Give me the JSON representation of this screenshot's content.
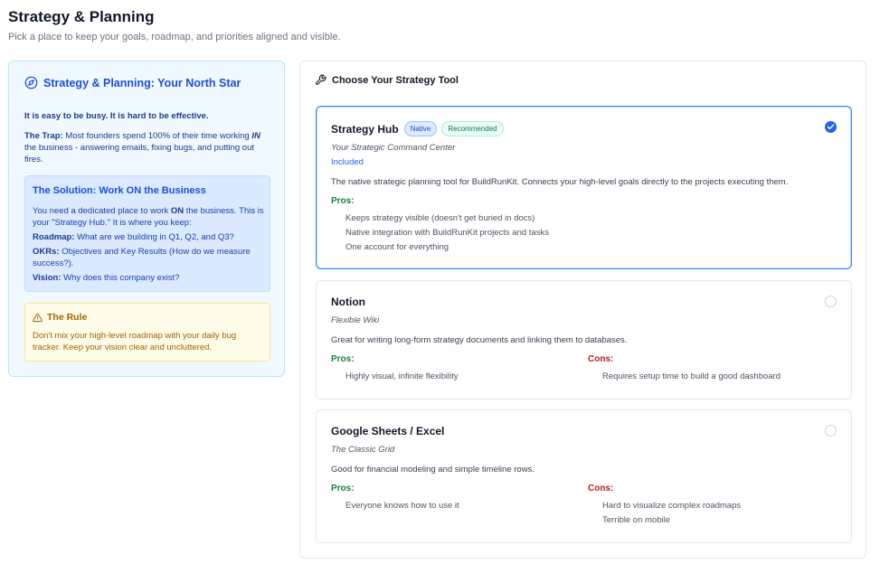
{
  "header": {
    "title": "Strategy & Planning",
    "subtitle": "Pick a place to keep your goals, roadmap, and priorities aligned and visible."
  },
  "info_panel": {
    "title": "Strategy & Planning: Your North Star",
    "lead": "It is easy to be busy. It is hard to be effective.",
    "trap_label": "The Trap:",
    "trap_text_1": " Most founders spend 100% of their time working ",
    "trap_emph": "IN",
    "trap_text_2": " the business - answering emails, fixing bugs, and putting out fires.",
    "solution": {
      "title": "The Solution: Work ON the Business",
      "intro_1": "You need a dedicated place to work ",
      "intro_emph": "ON",
      "intro_2": " the business. This is your \"Strategy Hub.\" It is where you keep:",
      "items": [
        {
          "label": "Roadmap:",
          "text": " What are we building in Q1, Q2, and Q3?"
        },
        {
          "label": "OKRs:",
          "text": " Objectives and Key Results (How do we measure success?)."
        },
        {
          "label": "Vision:",
          "text": " Why does this company exist?"
        }
      ]
    },
    "rule": {
      "title": "The Rule",
      "text": "Don't mix your high-level roadmap with your daily bug tracker. Keep your vision clear and uncluttered."
    }
  },
  "tool_panel": {
    "title": "Choose Your Strategy Tool",
    "options": [
      {
        "name": "Strategy Hub",
        "badges": [
          "Native",
          "Recommended"
        ],
        "tagline": "Your Strategic Command Center",
        "included": "Included",
        "description": "The native strategic planning tool for BuildRunKit. Connects your high-level goals directly to the projects executing them.",
        "pros_label": "Pros:",
        "pros": [
          "Keeps strategy visible (doesn't get buried in docs)",
          "Native integration with BuildRunKit projects and tasks",
          "One account for everything"
        ],
        "selected": true
      },
      {
        "name": "Notion",
        "tagline": "Flexible Wiki",
        "description": "Great for writing long-form strategy documents and linking them to databases.",
        "pros_label": "Pros:",
        "cons_label": "Cons:",
        "pros": [
          "Highly visual, infinite flexibility"
        ],
        "cons": [
          "Requires setup time to build a good dashboard"
        ],
        "selected": false
      },
      {
        "name": "Google Sheets / Excel",
        "tagline": "The Classic Grid",
        "description": "Good for financial modeling and simple timeline rows.",
        "pros_label": "Pros:",
        "cons_label": "Cons:",
        "pros": [
          "Everyone knows how to use it"
        ],
        "cons": [
          "Hard to visualize complex roadmaps",
          "Terrible on mobile"
        ],
        "selected": false
      }
    ]
  },
  "colors": {
    "accent": "#2563eb",
    "pros": "#15803d",
    "cons": "#b91c1c",
    "rule": "#a16207"
  },
  "icons": {
    "info_heading": "compass-icon",
    "rule": "warning-triangle-icon",
    "tool_heading": "wrench-icon",
    "selected": "check-icon"
  }
}
